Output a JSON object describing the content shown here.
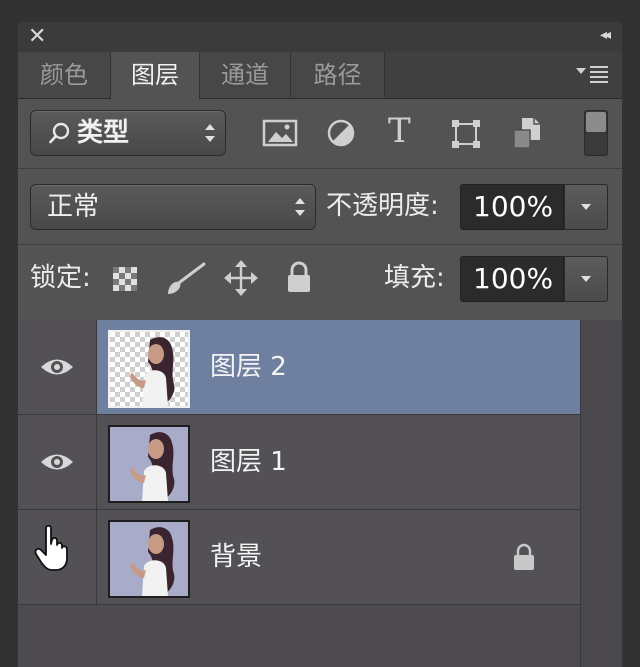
{
  "window": {
    "close_glyph": "✕",
    "collapse_glyph": "◂◂"
  },
  "tabs": [
    {
      "label": "颜色",
      "active": false
    },
    {
      "label": "图层",
      "active": true
    },
    {
      "label": "通道",
      "active": false
    },
    {
      "label": "路径",
      "active": false
    }
  ],
  "filter": {
    "kind_label": "类型",
    "icons": [
      "image-filter-icon",
      "adjustment-filter-icon",
      "text-filter-icon",
      "shape-filter-icon",
      "smart-object-filter-icon"
    ],
    "text_icon_glyph": "T"
  },
  "blend": {
    "mode": "正常",
    "opacity_label": "不透明度:",
    "opacity_value": "100%"
  },
  "lock": {
    "label": "锁定:",
    "fill_label": "填充:",
    "fill_value": "100%"
  },
  "layers": [
    {
      "name": "图层 2",
      "visible": true,
      "selected": true,
      "transparent": true,
      "locked": false
    },
    {
      "name": "图层 1",
      "visible": true,
      "selected": false,
      "transparent": false,
      "locked": false
    },
    {
      "name": "背景",
      "visible": false,
      "selected": false,
      "transparent": false,
      "locked": true
    }
  ],
  "colors": {
    "panel_bg": "#535353",
    "selected_row": "#6e7fa0",
    "field_bg": "#2b2b2b"
  }
}
